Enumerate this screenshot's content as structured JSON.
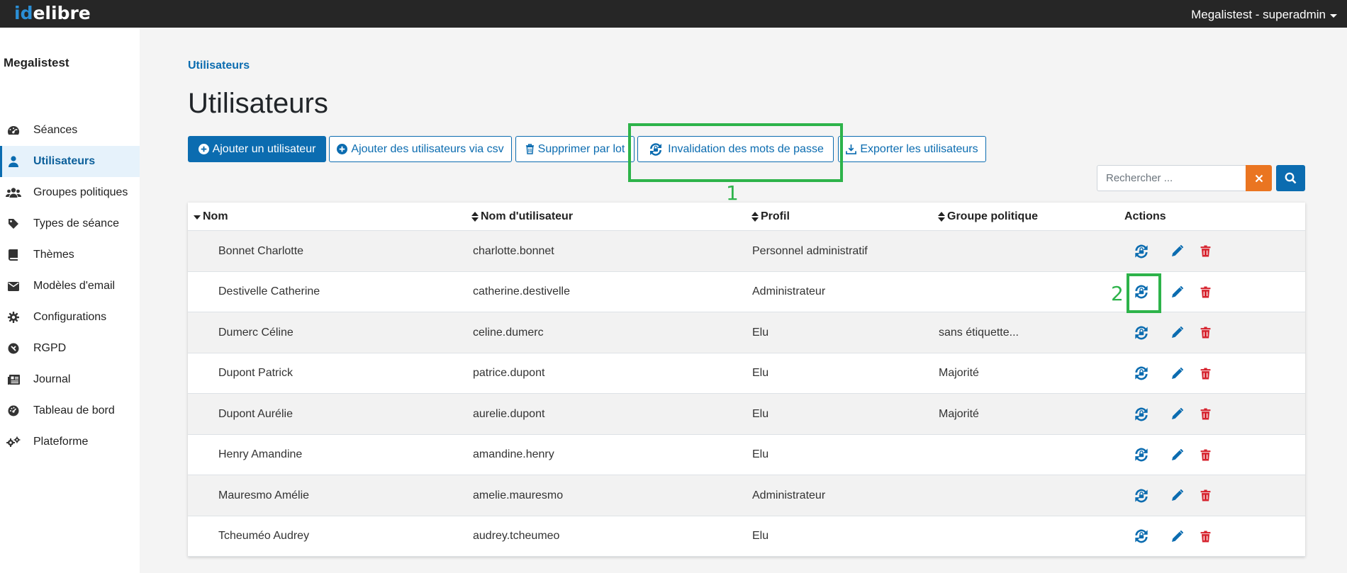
{
  "app": {
    "logo_id": "id",
    "logo_rest": "elibre",
    "user_menu": "Megalistest - superadmin"
  },
  "sidebar": {
    "structure_name": "Megalistest",
    "items": [
      {
        "label": "Séances",
        "icon": "gauge-icon",
        "active": false
      },
      {
        "label": "Utilisateurs",
        "icon": "user-icon",
        "active": true
      },
      {
        "label": "Groupes politiques",
        "icon": "users-group-icon",
        "active": false
      },
      {
        "label": "Types de séance",
        "icon": "tag-icon",
        "active": false
      },
      {
        "label": "Thèmes",
        "icon": "book-icon",
        "active": false
      },
      {
        "label": "Modèles d'email",
        "icon": "envelope-icon",
        "active": false
      },
      {
        "label": "Configurations",
        "icon": "gear-icon",
        "active": false
      },
      {
        "label": "RGPD",
        "icon": "shield-icon",
        "active": false
      },
      {
        "label": "Journal",
        "icon": "newspaper-icon",
        "active": false
      },
      {
        "label": "Tableau de bord",
        "icon": "dashboard-icon",
        "active": false
      },
      {
        "label": "Plateforme",
        "icon": "gears-icon",
        "active": false
      }
    ]
  },
  "breadcrumb": "Utilisateurs",
  "page_title": "Utilisateurs",
  "toolbar": {
    "add_user": "Ajouter un utilisateur",
    "add_csv": "Ajouter des utilisateurs via csv",
    "delete_batch": "Supprimer par lot",
    "invalidate_passwords": "Invalidation des mots de passe",
    "export_users": "Exporter les utilisateurs"
  },
  "annotations": {
    "box1_number": "1",
    "box2_number": "2"
  },
  "search": {
    "placeholder": "Rechercher ..."
  },
  "table": {
    "headers": {
      "name": "Nom",
      "username": "Nom d'utilisateur",
      "profile": "Profil",
      "group": "Groupe politique",
      "actions": "Actions"
    },
    "rows": [
      {
        "name": "Bonnet Charlotte",
        "username": "charlotte.bonnet",
        "profile": "Personnel administratif",
        "group": ""
      },
      {
        "name": "Destivelle Catherine",
        "username": "catherine.destivelle",
        "profile": "Administrateur",
        "group": ""
      },
      {
        "name": "Dumerc Céline",
        "username": "celine.dumerc",
        "profile": "Elu",
        "group": "sans étiquette..."
      },
      {
        "name": "Dupont Patrick",
        "username": "patrice.dupont",
        "profile": "Elu",
        "group": "Majorité"
      },
      {
        "name": "Dupont Aurélie",
        "username": "aurelie.dupont",
        "profile": "Elu",
        "group": "Majorité"
      },
      {
        "name": "Henry Amandine",
        "username": "amandine.henry",
        "profile": "Elu",
        "group": ""
      },
      {
        "name": "Mauresmo Amélie",
        "username": "amelie.mauresmo",
        "profile": "Administrateur",
        "group": ""
      },
      {
        "name": "Tcheuméo Audrey",
        "username": "audrey.tcheumeo",
        "profile": "Elu",
        "group": ""
      }
    ]
  },
  "colors": {
    "primary": "#0b6cb0",
    "danger": "#d6232e",
    "highlight": "#2db34a",
    "clear": "#ea7521"
  }
}
